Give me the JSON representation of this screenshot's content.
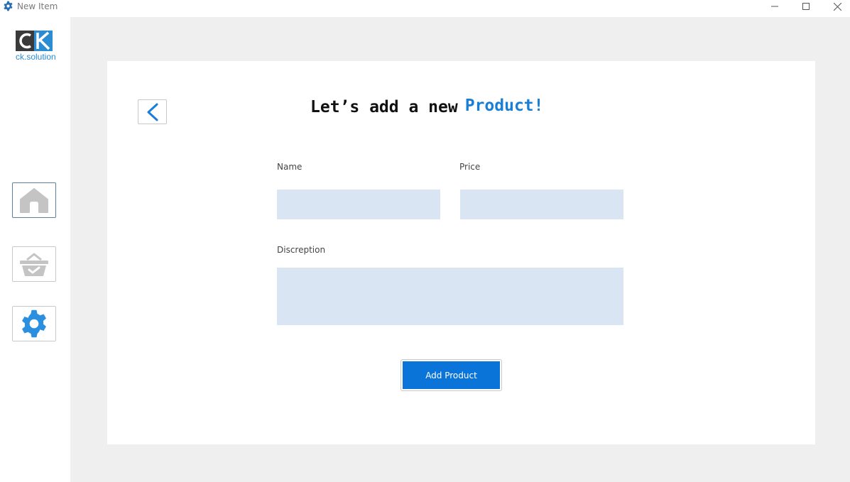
{
  "window": {
    "title": "New Item",
    "icon": "gear-icon",
    "controls": [
      "minimize-icon",
      "maximize-icon",
      "close-icon"
    ]
  },
  "sidebar": {
    "logo_text": "ck.solution",
    "logo_letters": "CK",
    "items": [
      {
        "name": "home",
        "icon": "home-icon",
        "active": true
      },
      {
        "name": "basket",
        "icon": "basket-check-icon",
        "active": false
      },
      {
        "name": "settings",
        "icon": "gear-icon",
        "active": false
      }
    ]
  },
  "form": {
    "back_icon": "chevron-left-icon",
    "heading_main": "Let’s add a new",
    "heading_accent": "Product!",
    "name_label": "Name",
    "name_value": "",
    "price_label": "Price",
    "price_value": "",
    "description_label": "Discreption",
    "description_value": "",
    "submit_label": "Add Product"
  },
  "colors": {
    "accent": "#1a7fd4",
    "button": "#0a74d8",
    "field_bg": "#d9e5f2",
    "backdrop": "#efefef",
    "logo_blue": "#2a8dd4",
    "icon_grey": "#c4c4c4",
    "gear_blue": "#2b8fe0"
  }
}
